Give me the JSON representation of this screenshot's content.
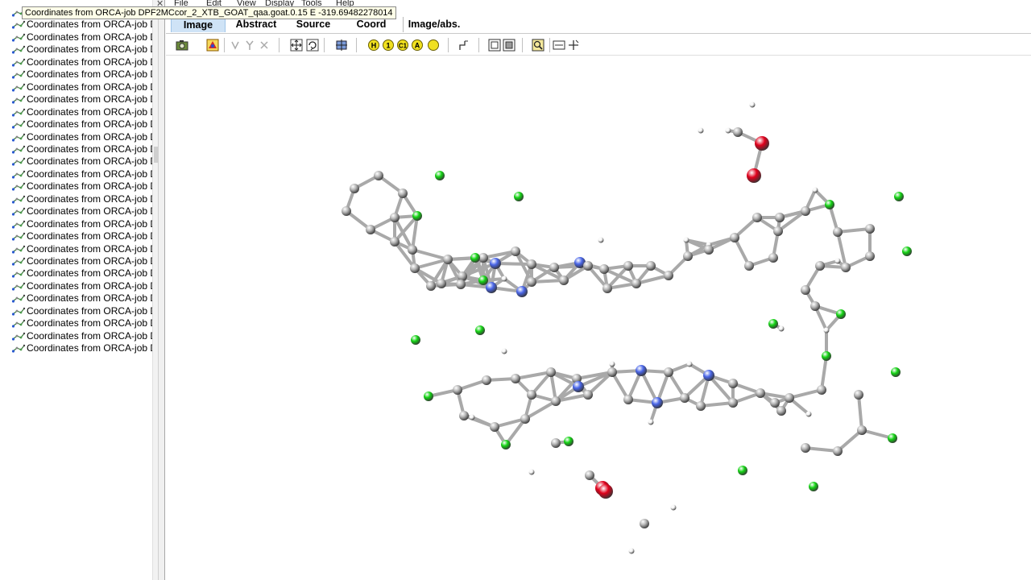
{
  "menu": [
    "File",
    "Edit",
    "View",
    "Display",
    "Tools",
    "Help"
  ],
  "tooltip": "Coordinates from ORCA-job DPF2MCcor_2_XTB_GOAT_qaa.goat.0.15 E -319.69482278014",
  "sidebar": {
    "items": [
      {
        "label": "Coordinates from ORCA-job DI"
      },
      {
        "label": "Coordinates from ORCA-job DI"
      },
      {
        "label": "Coordinates from ORCA-job DI"
      },
      {
        "label": "Coordinates from ORCA-job DI"
      },
      {
        "label": "Coordinates from ORCA-job DI"
      },
      {
        "label": "Coordinates from ORCA-job DI"
      },
      {
        "label": "Coordinates from ORCA-job DI"
      },
      {
        "label": "Coordinates from ORCA-job DI"
      },
      {
        "label": "Coordinates from ORCA-job DI"
      },
      {
        "label": "Coordinates from ORCA-job DI"
      },
      {
        "label": "Coordinates from ORCA-job DI"
      },
      {
        "label": "Coordinates from ORCA-job DI"
      },
      {
        "label": "Coordinates from ORCA-job DI"
      },
      {
        "label": "Coordinates from ORCA-job DI"
      },
      {
        "label": "Coordinates from ORCA-job DI"
      },
      {
        "label": "Coordinates from ORCA-job DI"
      },
      {
        "label": "Coordinates from ORCA-job DI"
      },
      {
        "label": "Coordinates from ORCA-job DI"
      },
      {
        "label": "Coordinates from ORCA-job DI"
      },
      {
        "label": "Coordinates from ORCA-job DI"
      },
      {
        "label": "Coordinates from ORCA-job DI"
      },
      {
        "label": "Coordinates from ORCA-job DI"
      },
      {
        "label": "Coordinates from ORCA-job DI"
      },
      {
        "label": "Coordinates from ORCA-job DI"
      },
      {
        "label": "Coordinates from ORCA-job DI"
      },
      {
        "label": "Coordinates from ORCA-job DI"
      },
      {
        "label": "Coordinates from ORCA-job DI"
      },
      {
        "label": "Coordinates from ORCA-job DI"
      }
    ]
  },
  "tabs": [
    {
      "label": "Image",
      "active": true
    },
    {
      "label": "Abstract",
      "active": false
    },
    {
      "label": "Source",
      "active": false
    },
    {
      "label": "Coord",
      "active": false
    },
    {
      "label": "Image/abs.",
      "active": false
    }
  ],
  "toolbar": {
    "buttons": [
      {
        "name": "camera-icon"
      },
      {
        "name": "render-icon"
      },
      {
        "name": "tool-a-icon"
      },
      {
        "name": "tool-b-icon"
      },
      {
        "name": "tool-c-icon"
      },
      {
        "name": "fit-icon"
      },
      {
        "name": "rotate-icon"
      },
      {
        "name": "move-icon"
      },
      {
        "name": "hydrogen-label",
        "text": "H"
      },
      {
        "name": "number-label",
        "text": "1"
      },
      {
        "name": "c1-label",
        "text": "C1"
      },
      {
        "name": "atom-a-label",
        "text": "A"
      },
      {
        "name": "circle-icon"
      },
      {
        "name": "measure-icon"
      },
      {
        "name": "frame-a-icon"
      },
      {
        "name": "frame-b-icon"
      },
      {
        "name": "zoom-icon"
      },
      {
        "name": "select-icon"
      },
      {
        "name": "add-icon"
      }
    ]
  },
  "colors": {
    "carbon": "#b4b4b4",
    "nitrogen": "#4a66e8",
    "oxygen": "#e0001b",
    "chlorine": "#14d414",
    "hydrogen": "#f4f4f4",
    "active_tab": "#cfe3f6"
  }
}
